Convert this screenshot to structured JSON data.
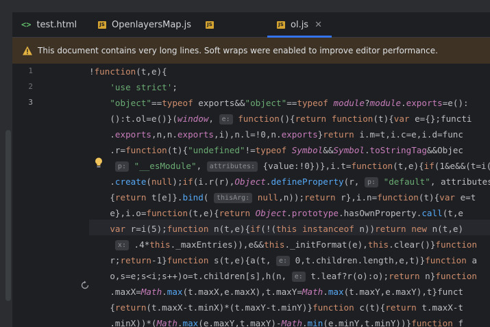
{
  "tabs": [
    {
      "icon": "html-icon",
      "label": "test.html",
      "active": false
    },
    {
      "icon": "js-icon",
      "label": "OpenlayersMap.js",
      "active": false
    },
    {
      "icon": "js-icon",
      "label": "",
      "active": false
    },
    {
      "icon": "js-icon",
      "label": "ol.js",
      "active": true
    }
  ],
  "js_badge": "JS",
  "html_badge": "<>",
  "close_glyph": "✕",
  "banner": {
    "text": "This document contains very long lines. Soft wraps were enabled to improve editor performance.",
    "accent": "#e2b341"
  },
  "gutter": {
    "line_numbers": [
      "1",
      "2",
      "3"
    ]
  },
  "code_lines": [
    "!function(t,e){",
    "    'use strict';",
    "    \"object\"==typeof exports&&\"object\"==typeof module?module.exports=e():",
    "    ():t.ol=e()}(window, e: function(){return function(t){var e={};functi",
    "    .exports,n,n.exports,i),n.l=!0,n.exports}return i.m=t,i.c=e,i.d=func",
    "    .r=function(t){\"undefined\"!=typeof Symbol&&Symbol.toStringTag&&Objec",
    "     p: \"__esModule\", attributes: {value:!0})},i.t=function(t,e){if(1&e&&(t=i(",
    "    .create(null);if(i.r(r),Object.defineProperty(r, p: \"default\", attributes",
    "    {return t[e]}.bind( thisArg: null,n));return r},i.n=function(t){var e=t",
    "    e},i.o=function(t,e){return Object.prototype.hasOwnProperty.call(t,e",
    "    var r=i(5);function n(t,e){if(!(this instanceof n))return new n(t,e)",
    "     x: .4*this._maxEntries)),e&&this._initFormat(e),this.clear()}function",
    "    r;return-1}function s(t,e){a(t, e: 0,t.children.length,e,t)}function a",
    "    o,s=e;s<i;s++)o=t.children[s],h(n, e: t.leaf?r(o):o);return n}function",
    "    .maxX=Math.max(t.maxX,e.maxX),t.maxY=Math.max(t.maxY,e.maxY),t}funct",
    "    {return(t.maxX-t.minX)*(t.maxY-t.minY)}function c(t){return t.maxX-t",
    "    .minX))*(Math.max(e.maxY,t.maxY)-Math.min(e.minY,t.minY))}function f"
  ],
  "colors": {
    "keyword": "#cf8e6d",
    "string": "#6aab73",
    "function": "#56a8f5",
    "field": "#c77dbb",
    "number": "#2aacb8",
    "text": "#bcbec4"
  }
}
